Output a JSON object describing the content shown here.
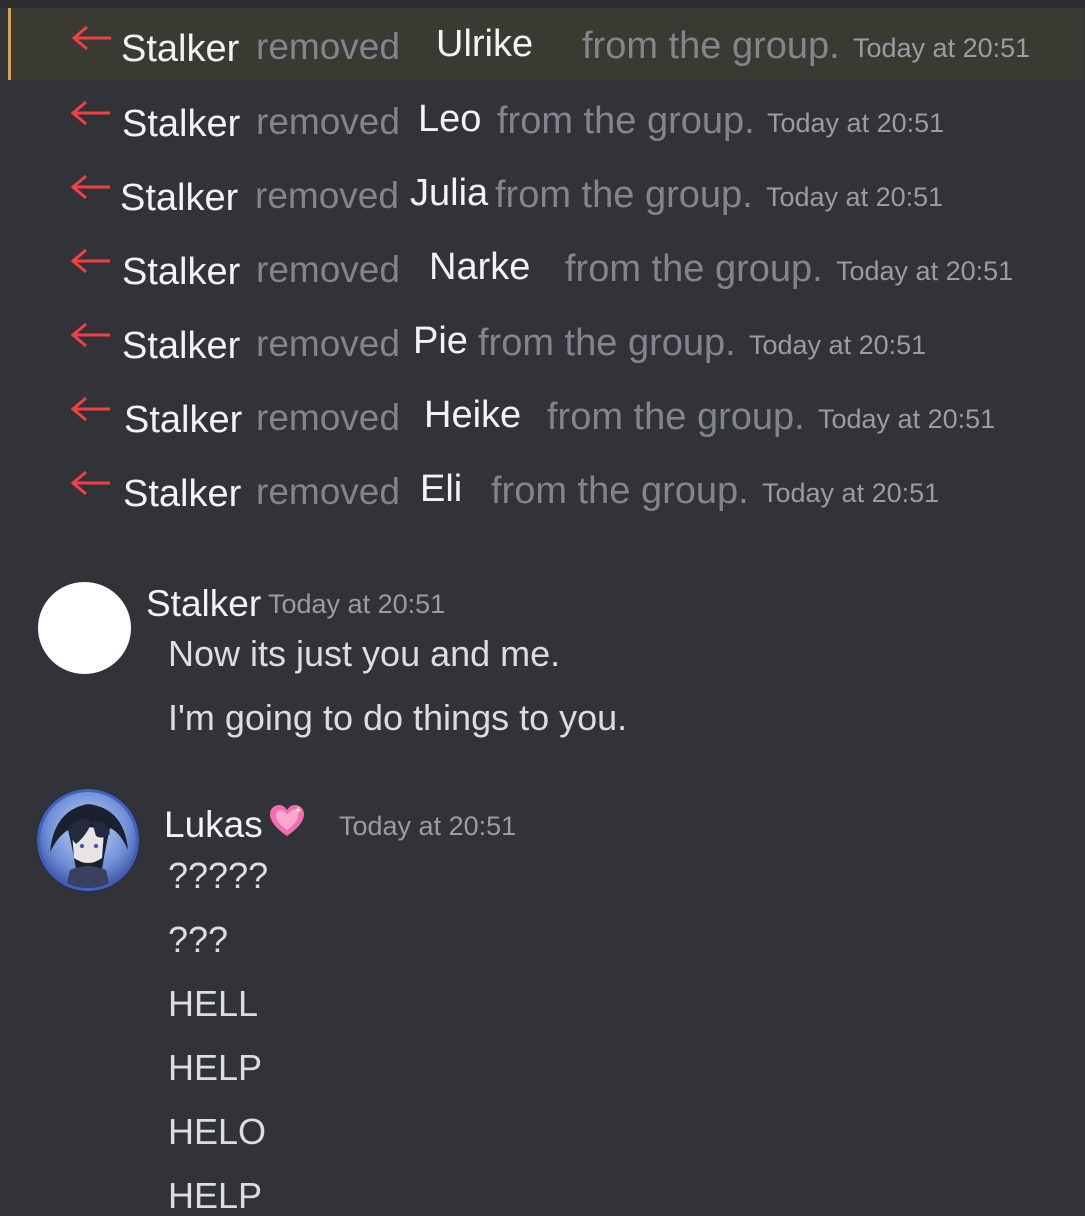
{
  "system_events": [
    {
      "actor": "Stalker",
      "verb": "removed",
      "target": "Ulrike",
      "rest": "from the group.",
      "time": "Today at 20:51"
    },
    {
      "actor": "Stalker",
      "verb": "removed",
      "target": "Leo",
      "rest": "from the group.",
      "time": "Today at 20:51"
    },
    {
      "actor": "Stalker",
      "verb": "removed",
      "target": "Julia",
      "rest": "from the group.",
      "time": "Today at 20:51"
    },
    {
      "actor": "Stalker",
      "verb": "removed",
      "target": "Narke",
      "rest": "from the group.",
      "time": "Today at 20:51"
    },
    {
      "actor": "Stalker",
      "verb": "removed",
      "target": "Pie",
      "rest": "from the group.",
      "time": "Today at 20:51"
    },
    {
      "actor": "Stalker",
      "verb": "removed",
      "target": "Heike",
      "rest": "from the group.",
      "time": "Today at 20:51"
    },
    {
      "actor": "Stalker",
      "verb": "removed",
      "target": "Eli",
      "rest": "from the group.",
      "time": "Today at 20:51"
    }
  ],
  "messages": [
    {
      "author": "Stalker",
      "time": "Today at 20:51",
      "lines": [
        "Now its just you and me.",
        "I'm going to do things to you."
      ]
    },
    {
      "author": "Lukas",
      "time": "Today at 20:51",
      "lines": [
        "?????",
        "???",
        "HELL",
        "HELP",
        "HELO",
        "HELP"
      ]
    }
  ],
  "colors": {
    "background": "#313338",
    "highlight": "#3a3a33",
    "highlight_bar": "#d9a53b",
    "leave_arrow": "#f23f43",
    "muted_text": "#82858b",
    "name_text": "#f2f3f5"
  },
  "icons": {
    "leave": "left-arrow-icon",
    "emoji": "sparkling-heart-icon"
  }
}
